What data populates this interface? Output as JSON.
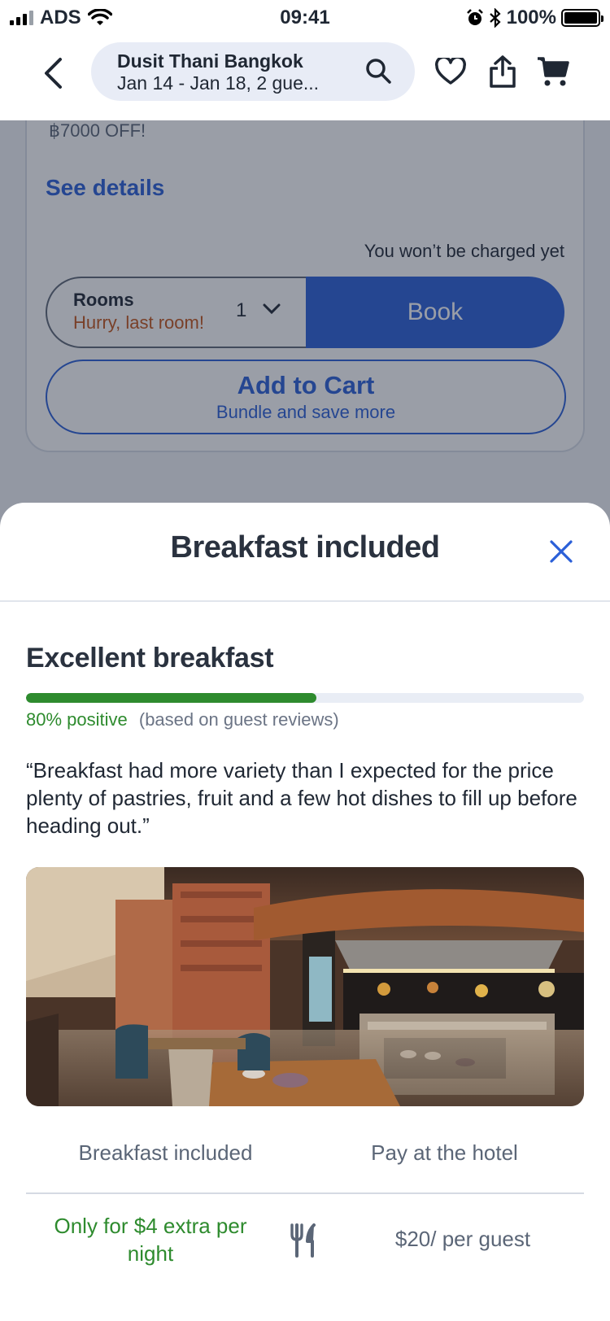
{
  "status_bar": {
    "carrier": "ADS",
    "time": "09:41",
    "battery": "100%"
  },
  "header": {
    "hotel_name": "Dusit Thani Bangkok",
    "dates_guests": "Jan 14 - Jan 18, 2 gue...",
    "icons": [
      "back-icon",
      "search-icon",
      "heart-icon",
      "share-icon",
      "cart-icon"
    ]
  },
  "background_card": {
    "discount_text": "฿7000 OFF!",
    "see_details": "See details",
    "charged_note": "You won’t be charged yet",
    "rooms_label": "Rooms",
    "rooms_hurry": "Hurry, last room!",
    "rooms_count": "1",
    "book_label": "Book",
    "cart_title": "Add to Cart",
    "cart_subtitle": "Bundle and save more"
  },
  "sheet": {
    "title": "Breakfast included",
    "rating_title": "Excellent breakfast",
    "positive_percent": 80,
    "positive_text": "80% positive",
    "based_text": "(based on guest reviews)",
    "quote": "“Breakfast had more variety than I expected for the price plenty of pastries, fruit and a few hot dishes to fill up before heading out.”",
    "label_left": "Breakfast included",
    "label_right": "Pay at the hotel",
    "price_left": "Only for $4 extra per night",
    "price_right": "$20/ per guest"
  },
  "colors": {
    "accent_blue": "#2a5fd8",
    "positive_green": "#2e8b2e",
    "warning_orange": "#c4551a"
  }
}
